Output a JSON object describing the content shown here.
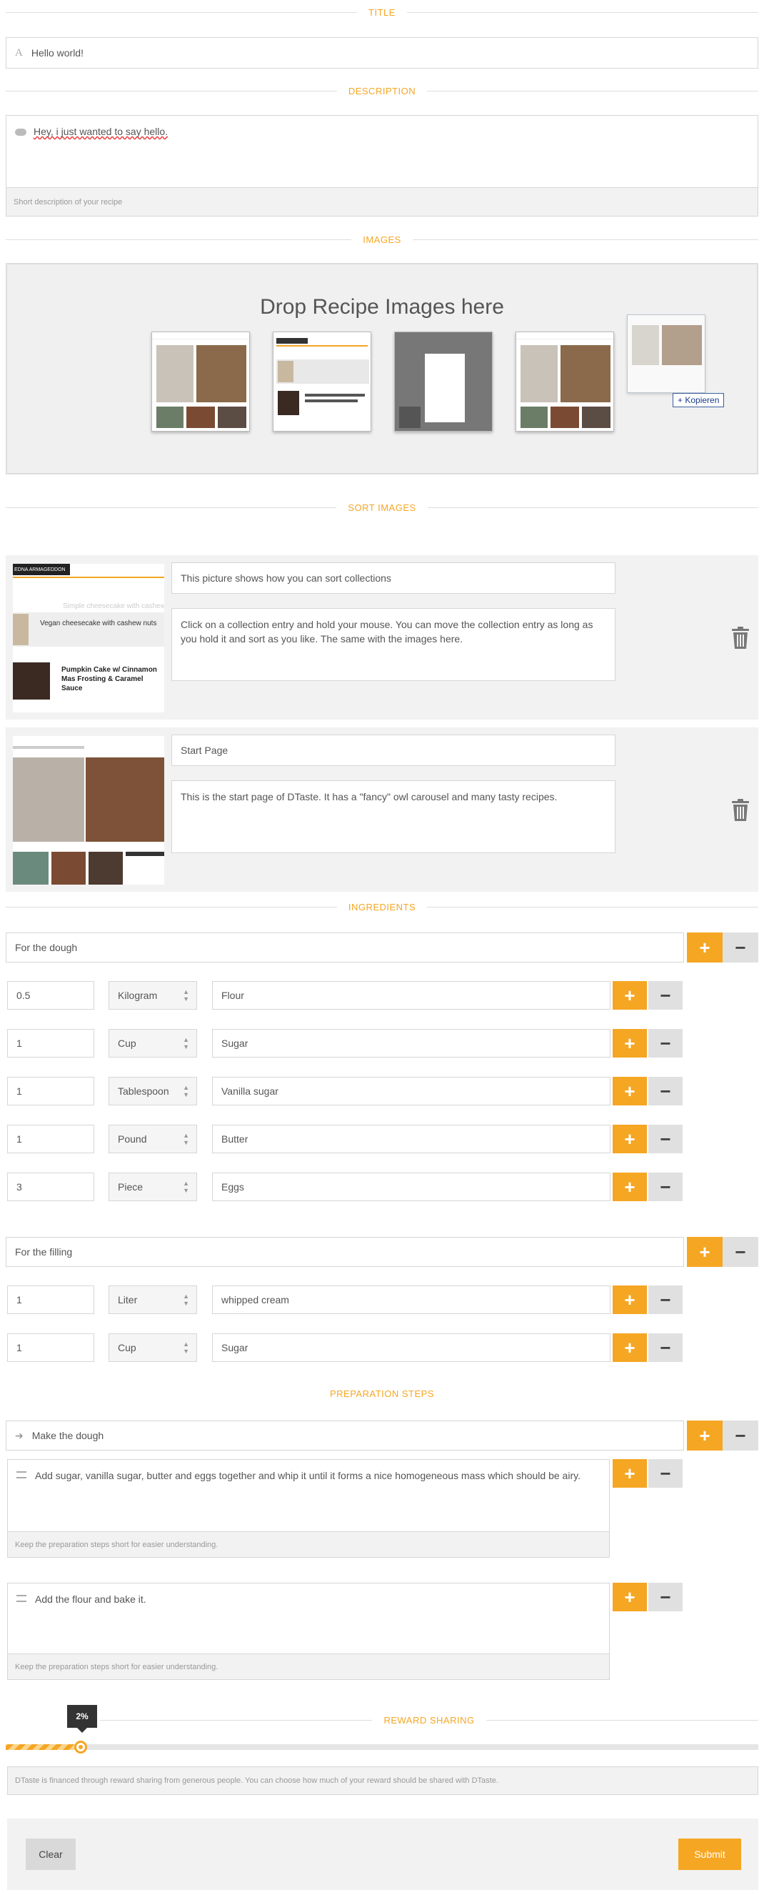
{
  "sections": {
    "title": "TITLE",
    "description": "DESCRIPTION",
    "images": "IMAGES",
    "sort_images": "SORT IMAGES",
    "ingredients": "INGREDIENTS",
    "preparation_steps": "PREPARATION STEPS",
    "reward_sharing": "REWARD SHARING"
  },
  "title_field": {
    "value": "Hello world!",
    "icon": "font-icon"
  },
  "description_field": {
    "value": "Hey, i just wanted to say hello.",
    "hint": "Short description of your recipe",
    "icon": "comment-icon"
  },
  "dropzone": {
    "heading": "Drop Recipe Images here",
    "copy_label": "+ Kopieren"
  },
  "sort_items": [
    {
      "title": "This picture shows how you can sort collections",
      "description": "Click on a collection entry and hold your mouse. You can move the collection entry as long as you hold it and sort as you like. The same with the images here.",
      "thumb_header": "EDNA ARMAGEDDON",
      "thumb_items": [
        "Simple cheesecake with cashew",
        "Vegan cheesecake with cashew nuts",
        "Pumpkin Cake w/ Cinnamon Mas Frosting & Caramel Sauce"
      ]
    },
    {
      "title": "Start Page",
      "description": "This is the start page of DTaste. It has a \"fancy\" owl carousel and many tasty recipes."
    }
  ],
  "ingredient_groups": [
    {
      "name": "For the dough",
      "items": [
        {
          "amount": "0.5",
          "unit": "Kilogram",
          "name": "Flour"
        },
        {
          "amount": "1",
          "unit": "Cup",
          "name": "Sugar"
        },
        {
          "amount": "1",
          "unit": "Tablespoon",
          "name": "Vanilla sugar"
        },
        {
          "amount": "1",
          "unit": "Pound",
          "name": "Butter"
        },
        {
          "amount": "3",
          "unit": "Piece",
          "name": "Eggs"
        }
      ]
    },
    {
      "name": "For the filling",
      "items": [
        {
          "amount": "1",
          "unit": "Liter",
          "name": "whipped cream"
        },
        {
          "amount": "1",
          "unit": "Cup",
          "name": "Sugar"
        }
      ]
    }
  ],
  "preparation": {
    "group_name": "Make the dough",
    "hint": "Keep the preparation steps short for easier understanding.",
    "steps": [
      "Add sugar, vanilla sugar, butter and eggs together  and whip it until it forms a nice homogeneous mass which should be airy.",
      "Add the flour and bake it."
    ]
  },
  "reward": {
    "percent": 2,
    "percent_label": "2%",
    "hint": "DTaste is financed through reward sharing from generous people. You can choose how much of your reward should be shared with DTaste."
  },
  "actions": {
    "clear": "Clear",
    "submit": "Submit"
  },
  "colors": {
    "accent": "#f5a623",
    "panel": "#f2f2f2",
    "border": "#d6d6d6"
  }
}
